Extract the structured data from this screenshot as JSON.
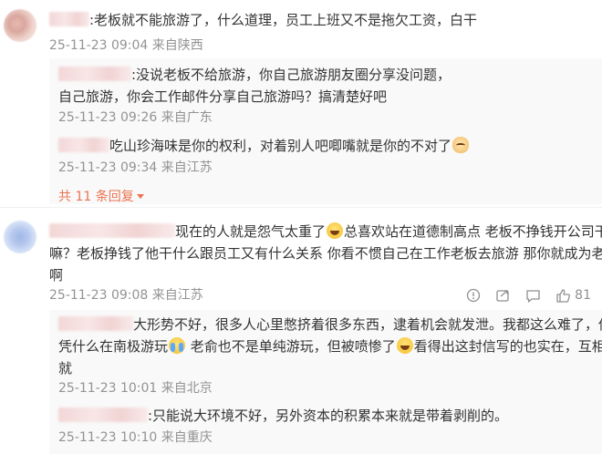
{
  "comment1": {
    "text": ":老板就不能旅游了，什么道理，员工上班又不是拖欠工资，白干",
    "time": "25-11-23 09:04",
    "location": "来自陕西",
    "replies": [
      {
        "line1": ":没说老板不给旅游，你自己旅游朋友圈分享没问题，",
        "line2": "自己旅游，你会工作邮件分享自己旅游吗？搞清楚好吧",
        "time": "25-11-23 09:26",
        "location": "来自广东"
      },
      {
        "line1": "吃山珍海味是你的权利，对着别人吧唧嘴就是你的不对了",
        "time": "25-11-23 09:34",
        "location": "来自江苏"
      }
    ],
    "more_replies": "共 11 条回复"
  },
  "comment2": {
    "line1_a": "现在的人就是怨气太重了",
    "line1_b": "总喜欢站在道德制高点 老板不挣钱开公司干",
    "line2": "嘛？老板挣钱了他干什么跟员工又有什么关系 你看不惯自己在工作老板去旅游 那你就成为老板",
    "line3": "啊",
    "time": "25-11-23 09:08",
    "location": "来自江苏",
    "like_count": "81",
    "replies": [
      {
        "line1": "大形势不好，很多人心里憋挤着很多东西，逮着机会就发泄。我都这么难了，你",
        "line2_a": "凭什么在南极游玩",
        "line2_b": " 老俞也不是单纯游玩，但被喷惨了",
        "line2_c": "看得出这封信写的也实在，互相成",
        "line3": "就",
        "time": "25-11-23 10:01",
        "location": "来自北京"
      },
      {
        "line1": ":只能说大环境不好，另外资本的积累本来就是带着剥削的。",
        "time": "25-11-23 10:10",
        "location": "来自重庆"
      }
    ]
  }
}
